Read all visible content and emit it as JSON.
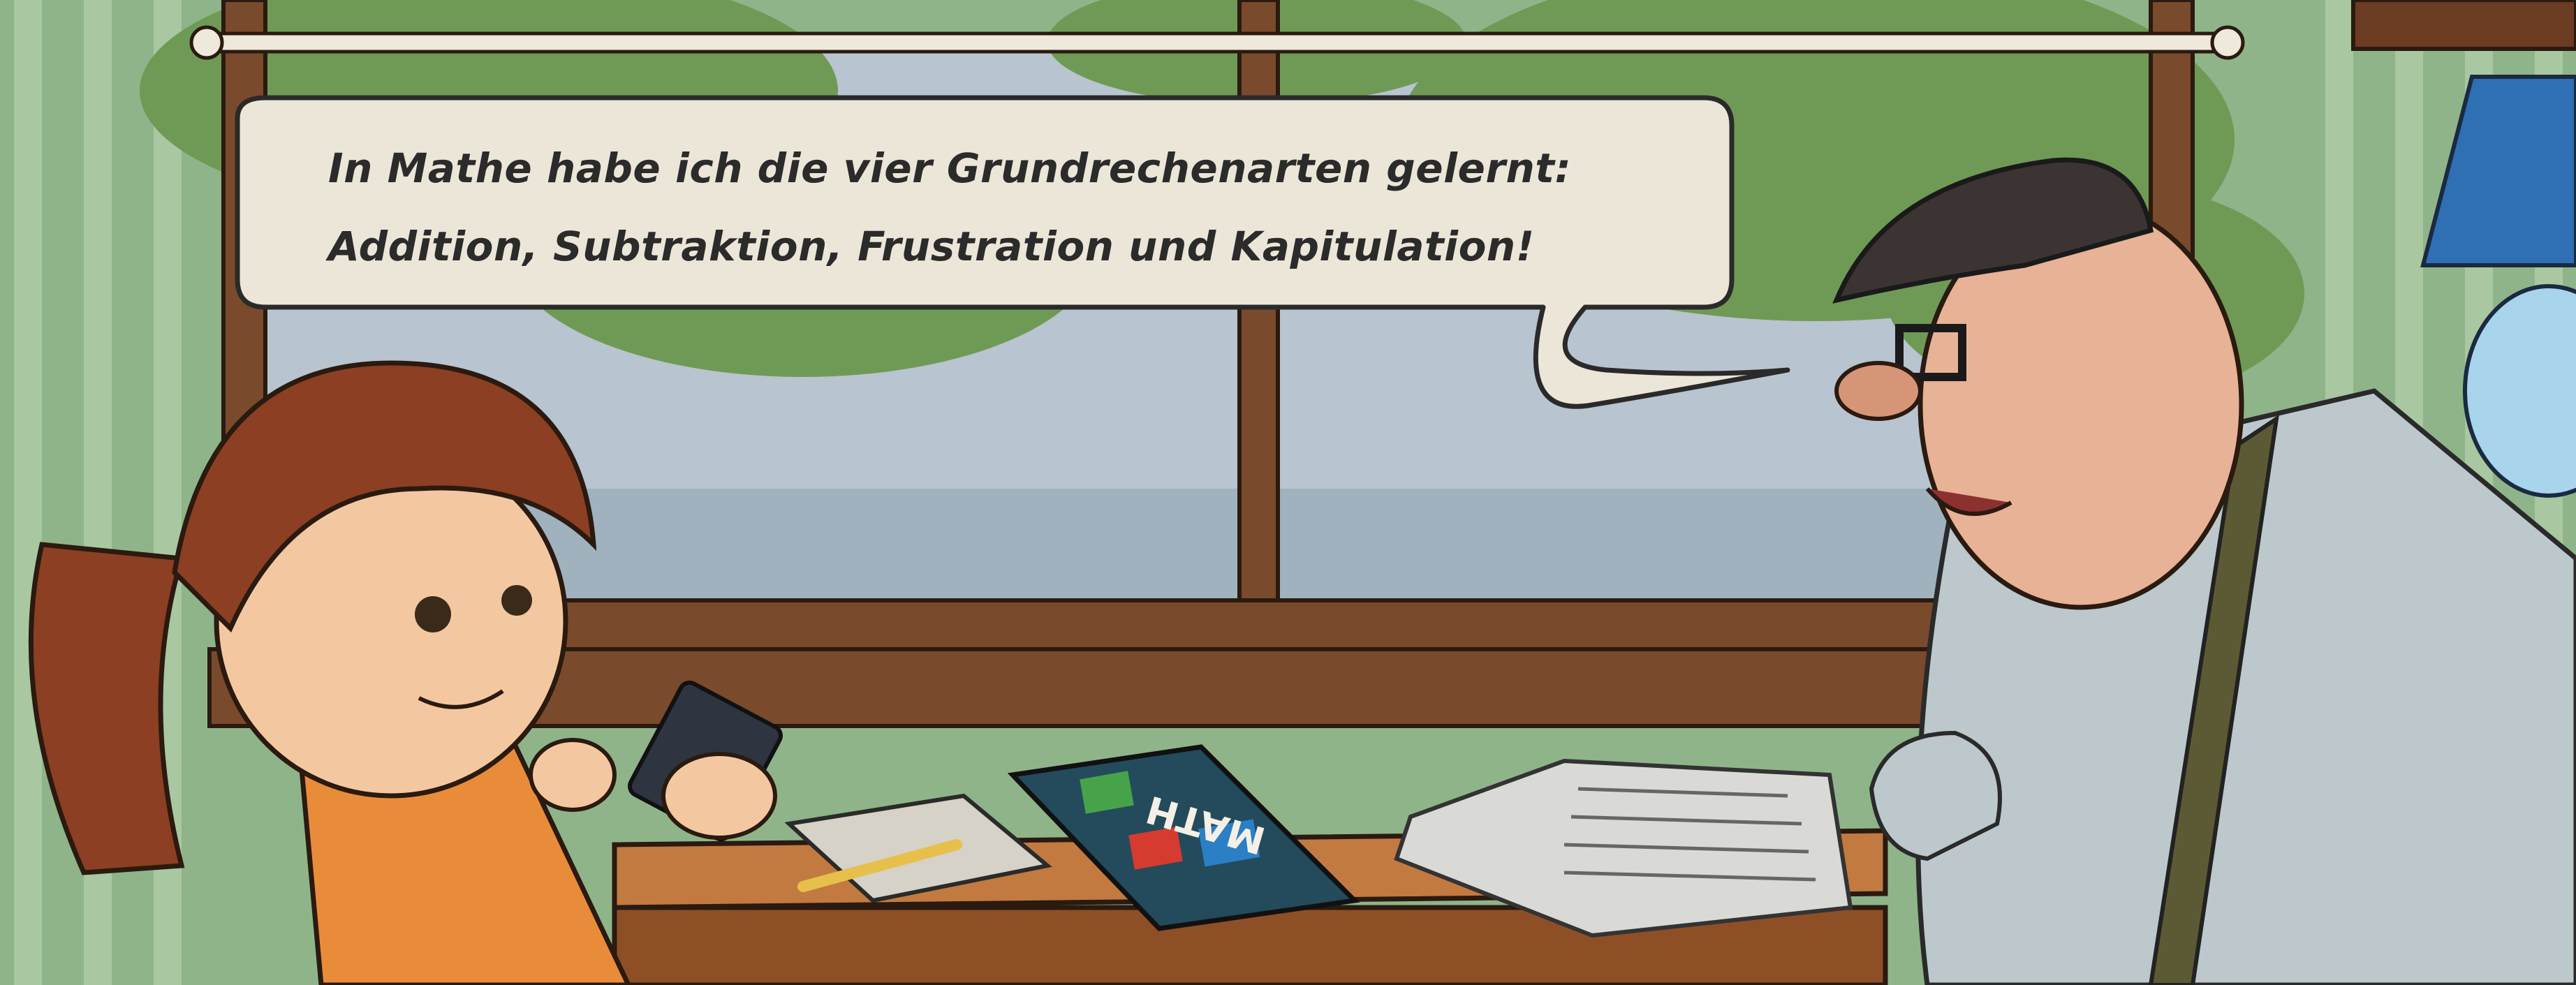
{
  "speech_bubble": {
    "line1": "In Mathe habe ich die vier Grundrechenarten gelernt:",
    "line2": "Addition, Subtraktion, Frustration und Kapitulation!"
  },
  "book": {
    "title": "MATH"
  },
  "colors": {
    "wallpaper": "#8fb48a",
    "wallpaper_stripe": "#a9c7a0",
    "window_frame": "#7a4a2c",
    "sky": "#b8c4cf",
    "tree": "#6f9a55",
    "bubble_fill": "#ebe6d8",
    "desk": "#b56a35",
    "girl_dress": "#e98c3a",
    "man_shirt": "#bcc8cc"
  }
}
